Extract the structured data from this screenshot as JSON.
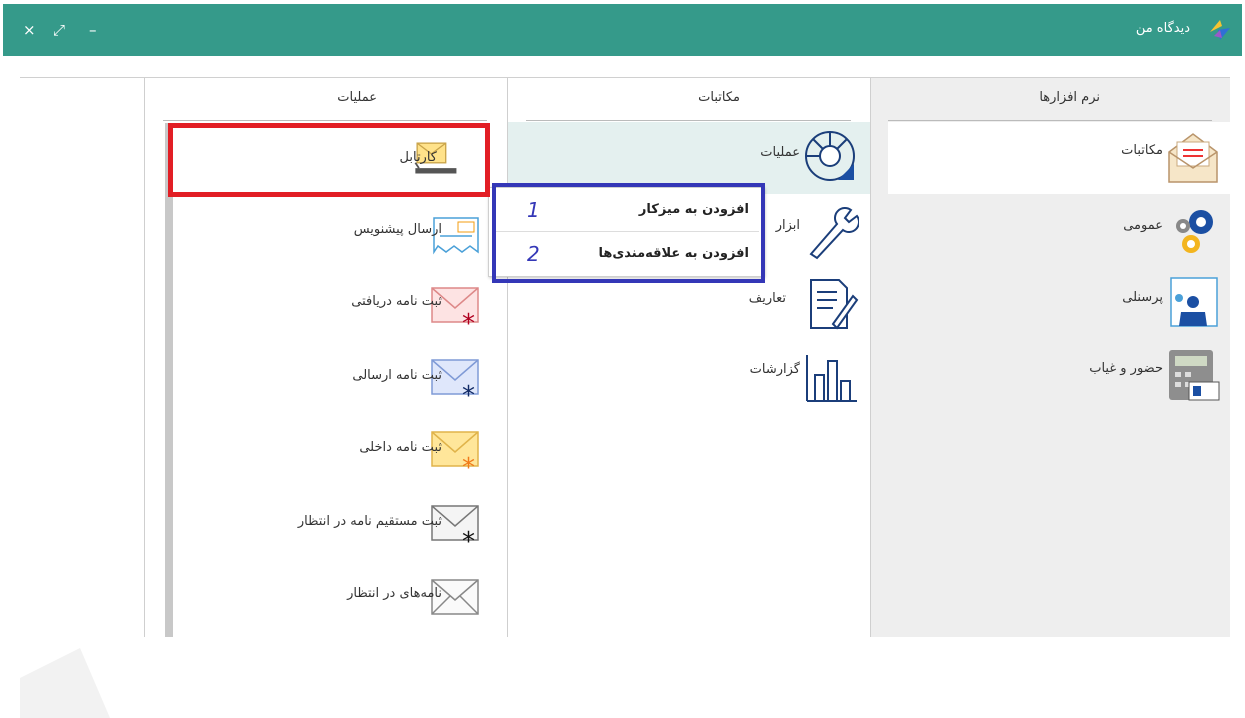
{
  "window": {
    "title": "دیدگاه من",
    "controls": {
      "minimize": "–",
      "maximize": "⤢",
      "close": "×"
    }
  },
  "columns": {
    "software": {
      "header": "نرم افزارها",
      "items": [
        "مکاتبات",
        "عمومی",
        "پرسنلی",
        "حضور و غیاب"
      ]
    },
    "correspondence": {
      "header": "مکاتبات",
      "items": [
        "عملیات",
        "ابزار",
        "تعاریف",
        "گزارشات"
      ]
    },
    "operations": {
      "header": "عملیات",
      "items": [
        "کارتابل",
        "ارسال پیشنویس",
        "ثبت نامه دریافتی",
        "ثبت نامه ارسالی",
        "ثبت نامه داخلی",
        "ثبت مستقیم نامه در انتظار",
        "نامه‌های در انتظار"
      ]
    }
  },
  "context_menu": {
    "items": [
      {
        "label": "افزودن به میزکار",
        "number": "1"
      },
      {
        "label": "افزودن به علاقه‌مندی‌ها",
        "number": "2"
      }
    ]
  },
  "colors": {
    "titlebar": "#359a8a",
    "highlight_red": "#e21e25",
    "highlight_blue": "#3437b7",
    "panel_bg": "#eeeeee"
  }
}
